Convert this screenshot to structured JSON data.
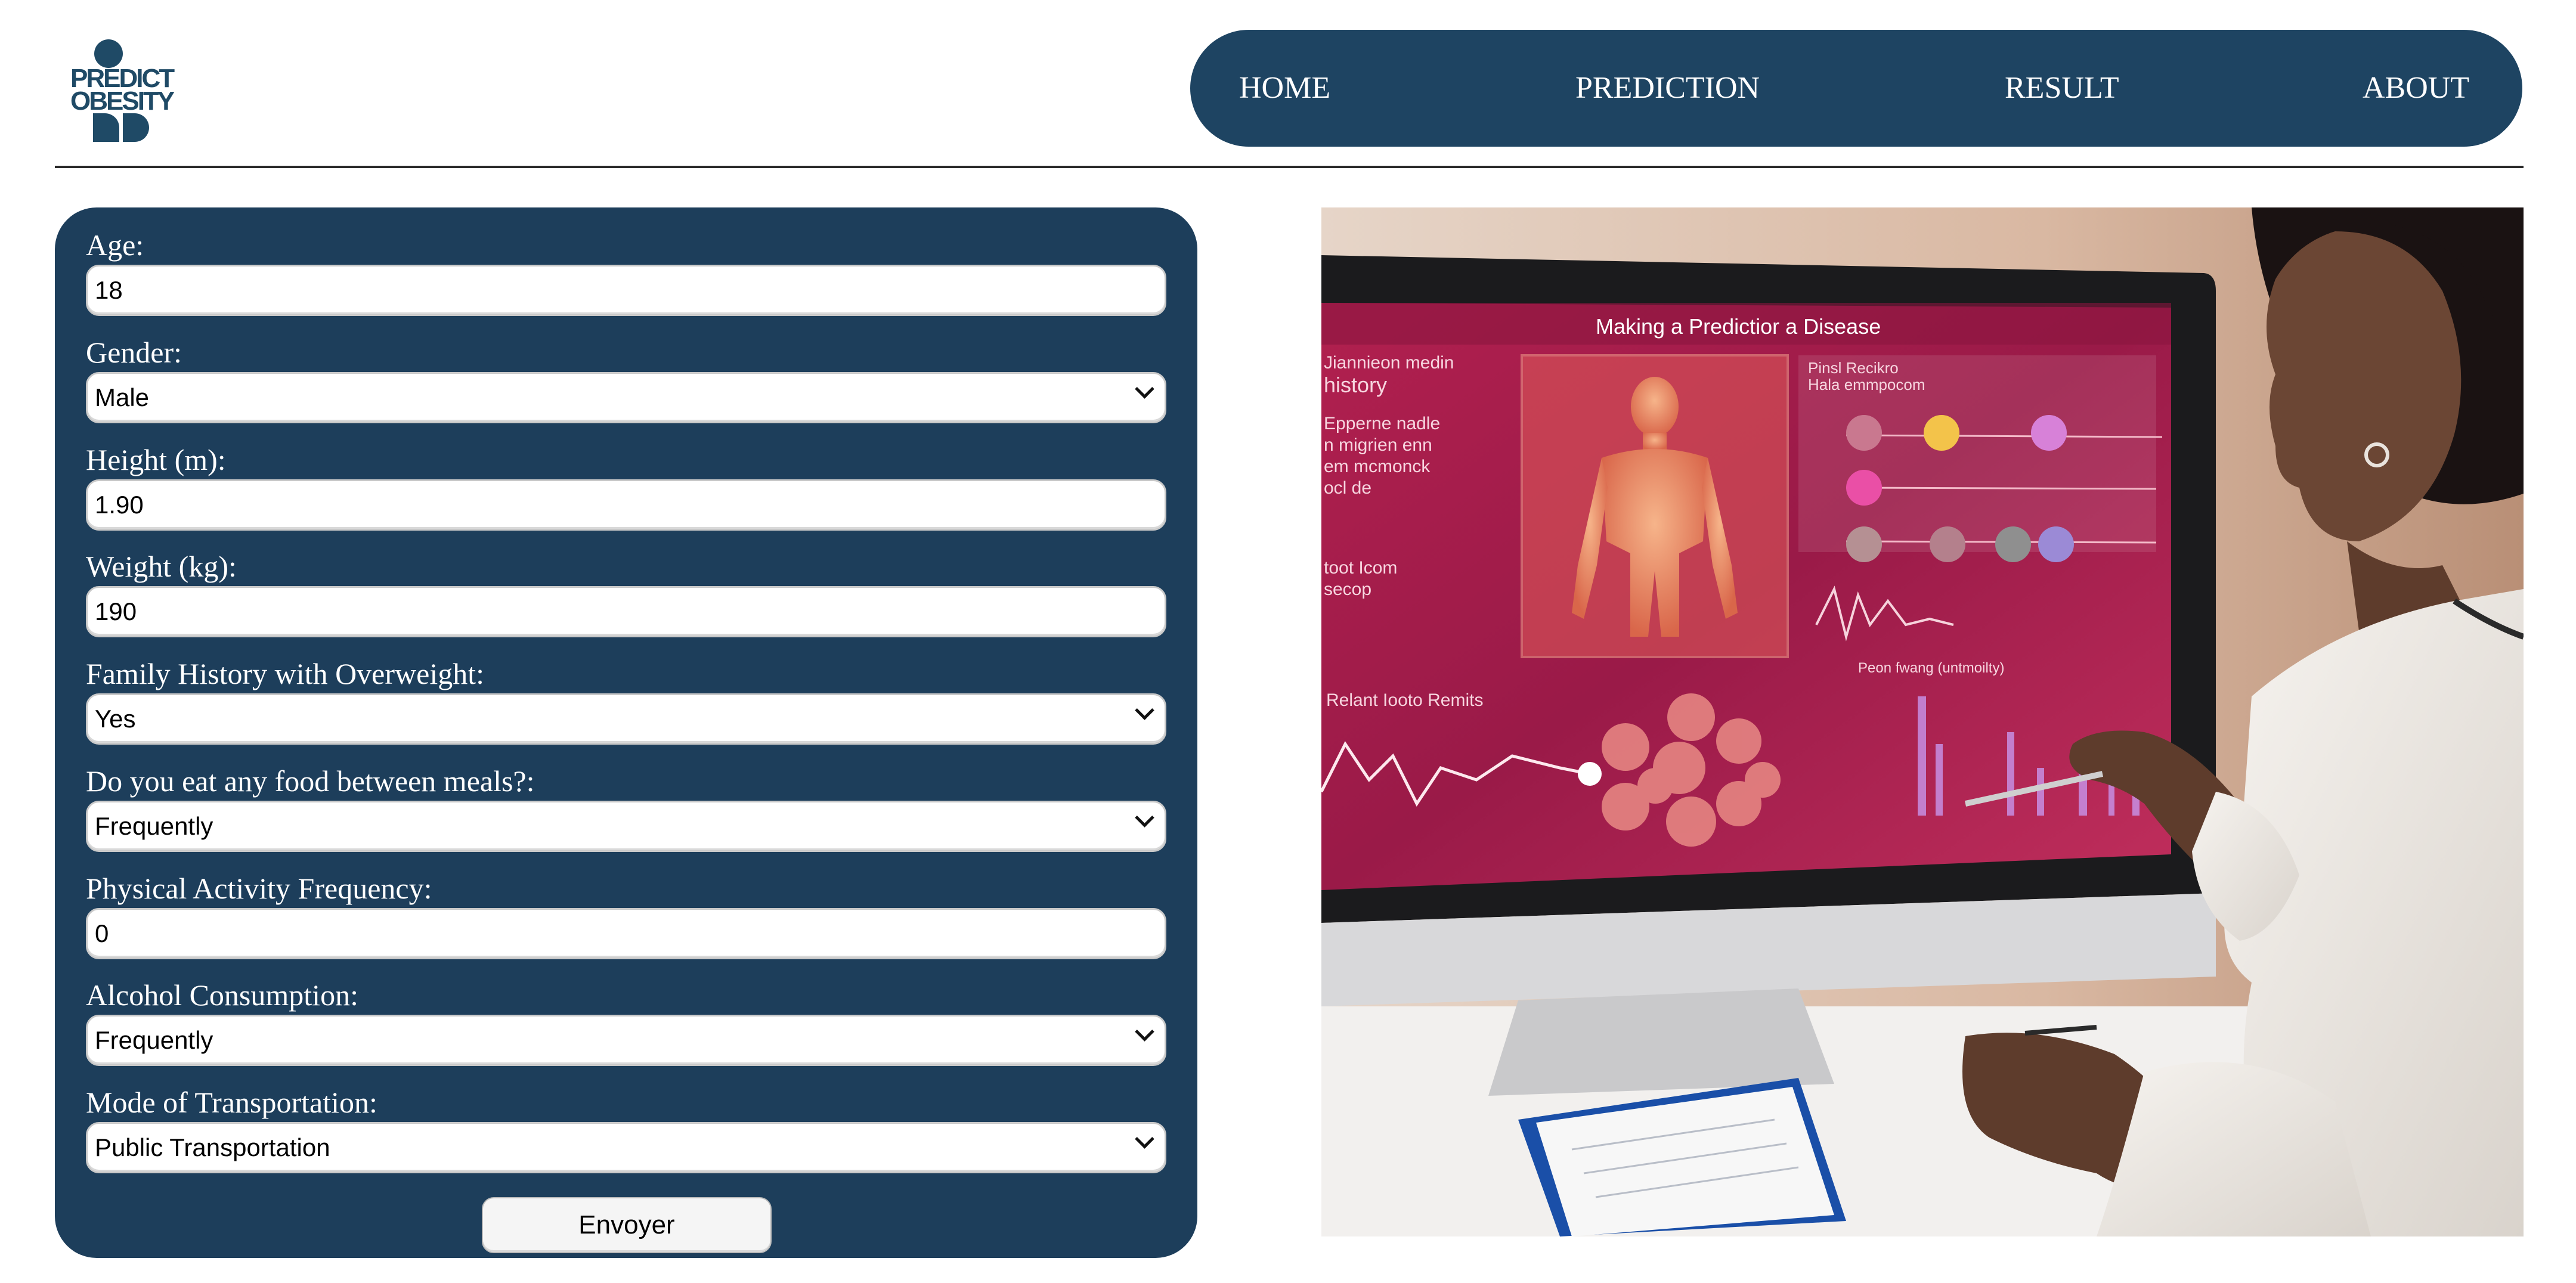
{
  "logo": {
    "line1": "PREDICT",
    "line2": "OBESITY"
  },
  "nav": {
    "home": "HOME",
    "prediction": "PREDICTION",
    "result": "RESULT",
    "about": "ABOUT"
  },
  "form": {
    "age": {
      "label": "Age:",
      "value": "18"
    },
    "gender": {
      "label": "Gender:",
      "value": "Male"
    },
    "height": {
      "label": "Height (m):",
      "value": "1.90"
    },
    "weight": {
      "label": "Weight (kg):",
      "value": "190"
    },
    "family_history": {
      "label": "Family History with Overweight:",
      "value": "Yes"
    },
    "snacking": {
      "label": "Do you eat any food between meals?:",
      "value": "Frequently"
    },
    "activity": {
      "label": "Physical Activity Frequency:",
      "value": "0"
    },
    "alcohol": {
      "label": "Alcohol Consumption:",
      "value": "Frequently"
    },
    "transport": {
      "label": "Mode of Transportation:",
      "value": "Public Transportation"
    },
    "submit_label": "Envoyer"
  },
  "hero": {
    "screen_title": "Making a Predictior a Disease",
    "left_text_1": "Jiannieon medin",
    "left_text_2": "history",
    "left_text_3": "Epperne nadle",
    "left_text_4": "n migrien enn",
    "left_text_5": "em mcmonck",
    "left_text_6": "ocl de",
    "left_text_7": "toot Icom",
    "left_text_8": "secop",
    "panel_label_1": "Pinsl Recikro",
    "panel_label_2": "Hala emmpocom",
    "bottom_left_label": "Relant Iooto Remits",
    "chart_label": "Peon fwang (untmoilty)"
  }
}
